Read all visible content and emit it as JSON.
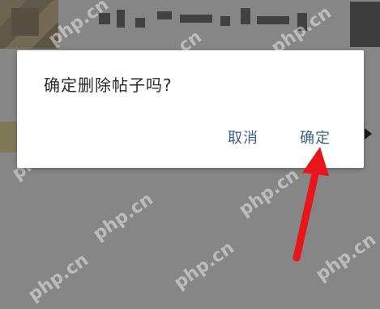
{
  "dialog": {
    "message": "确定删除帖子吗?",
    "cancel_label": "取消",
    "confirm_label": "确定"
  },
  "watermark": {
    "text": "php.cn"
  },
  "colors": {
    "overlay": "#868686",
    "dialog_bg": "#ffffff",
    "message_text": "#2a2a2a",
    "button_text": "#3f5f86",
    "arrow": "#e8161b"
  },
  "icons": {
    "annotation": "red-arrow-icon"
  }
}
